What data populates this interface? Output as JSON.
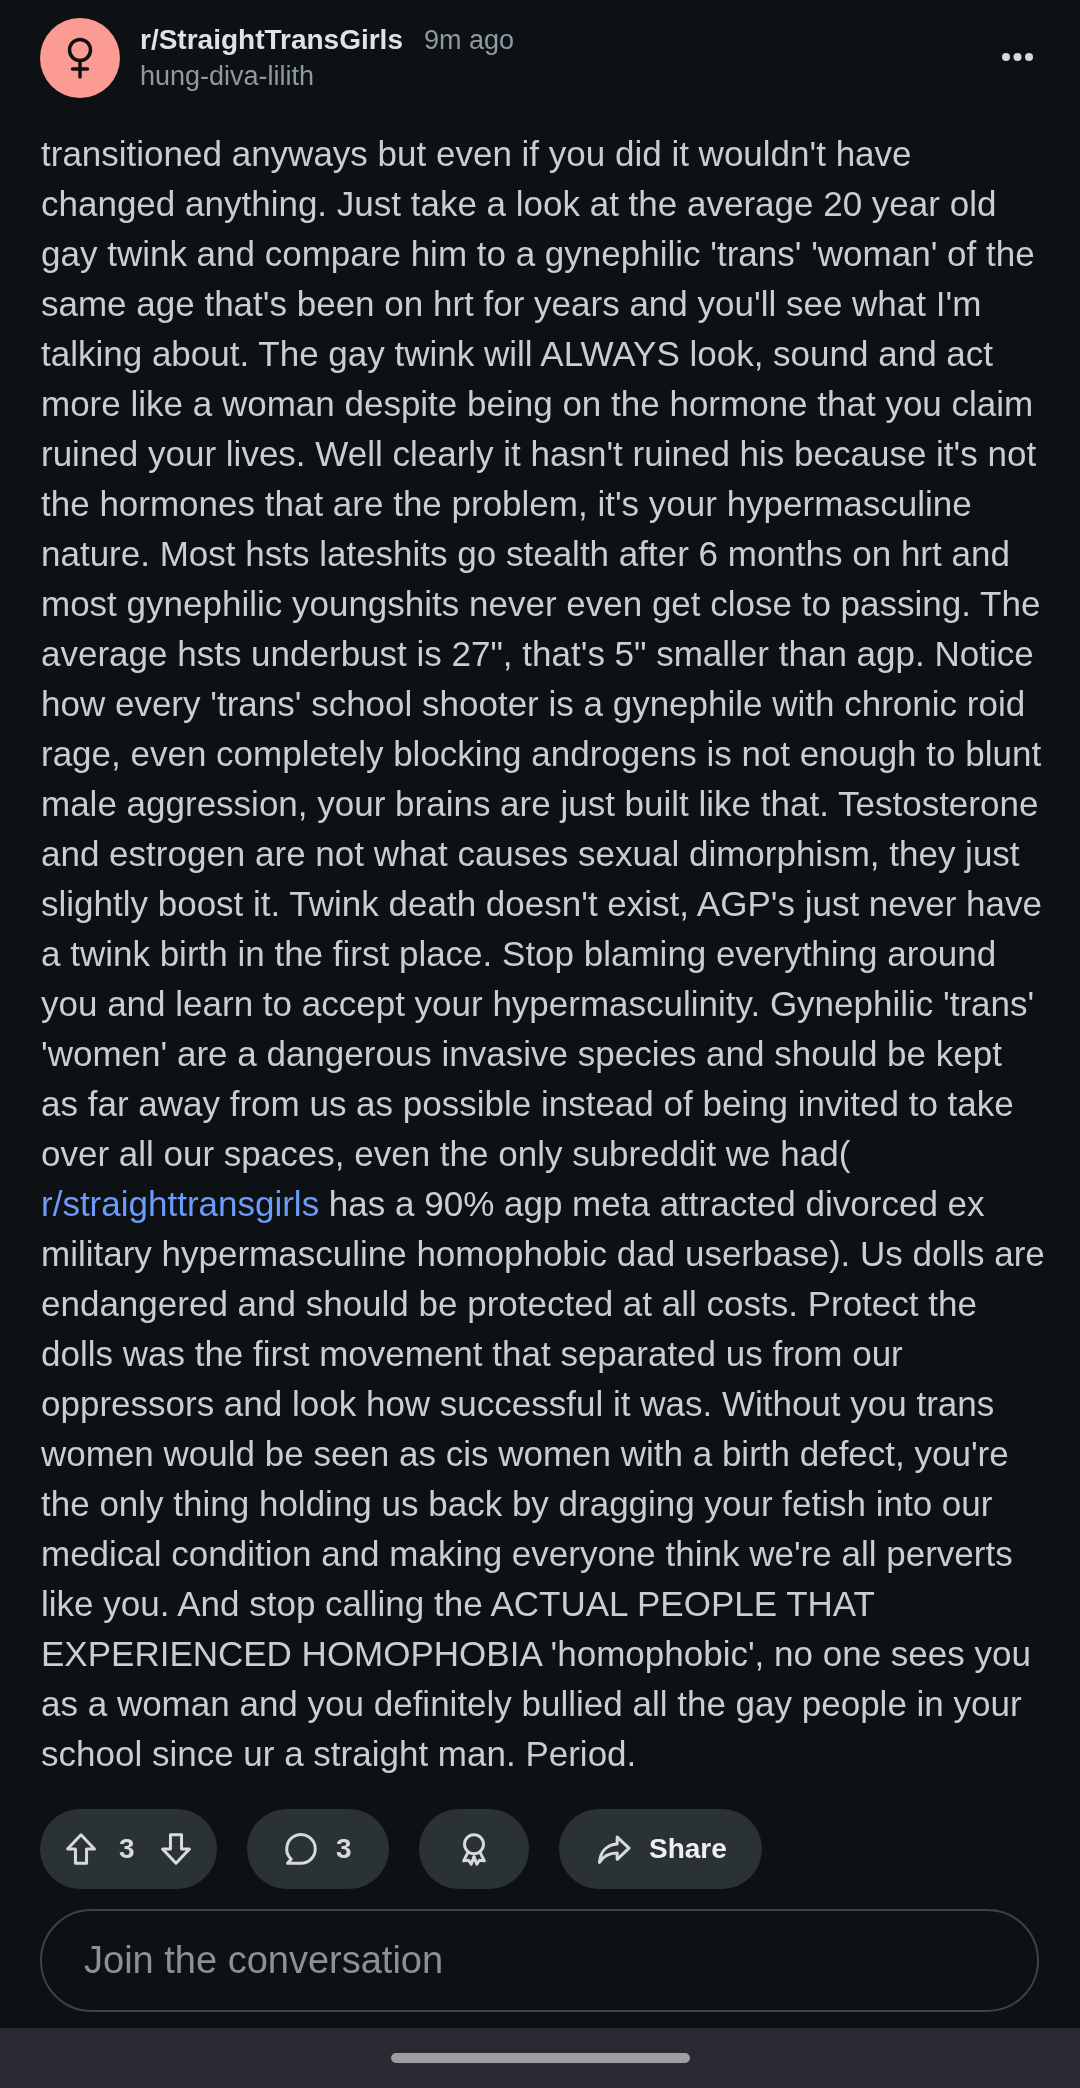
{
  "post": {
    "subreddit": "r/StraightTransGirls",
    "time": "9m ago",
    "author": "hung-diva-lilith",
    "body": [
      {
        "kind": "text",
        "text": "transitioned anyways but even if you did it wouldn't have changed anything. Just take a look at the average 20 year old gay twink and compare him to a gynephilic 'trans' 'woman' of the same age that's been on hrt for years and you'll see what I'm talking about. The gay twink will ALWAYS look, sound and act more like a woman despite being on the hormone that you claim ruined your lives. Well clearly it hasn't ruined his because it's not the hormones that are the problem, it's your hypermasculine nature. Most hsts lateshits go stealth after 6 months on hrt and most gynephilic youngshits never even get close to passing. The average hsts underbust is 27\", that's 5\" smaller than agp. Notice how every 'trans' school shooter is a gynephile with chronic roid rage, even completely blocking androgens is not enough to blunt male aggression, your brains are just built like that. Testosterone and estrogen are not what causes sexual dimorphism, they just slightly boost it. Twink death doesn't exist, AGP's just never have a twink birth in the first place. Stop blaming everything around you and learn to accept your hypermasculinity. Gynephilic 'trans' 'women' are a dangerous invasive species and should be kept as far away from us as possible instead of being invited to take over all our spaces, even the only subreddit we had("
      },
      {
        "kind": "link",
        "text": "r/straighttransgirls"
      },
      {
        "kind": "text",
        "text": " has a 90% agp meta attracted divorced ex military hypermasculine homophobic dad userbase). Us dolls are endangered and should be protected at all costs. Protect the dolls was the first movement that separated us from our oppressors and look how successful it was. Without you trans women would be seen as cis women with a birth defect, you're the only thing holding us back by dragging your fetish into our medical condition and making everyone think we're all perverts like you. And stop calling the ACTUAL PEOPLE THAT EXPERIENCED HOMOPHOBIA 'homophobic', no one sees you as a woman and you definitely bullied all the gay people in your school since ur a straight man. Period."
      }
    ]
  },
  "actions": {
    "votes": "3",
    "comments": "3",
    "share": "Share"
  },
  "comment_box": {
    "placeholder": "Join the conversation"
  }
}
